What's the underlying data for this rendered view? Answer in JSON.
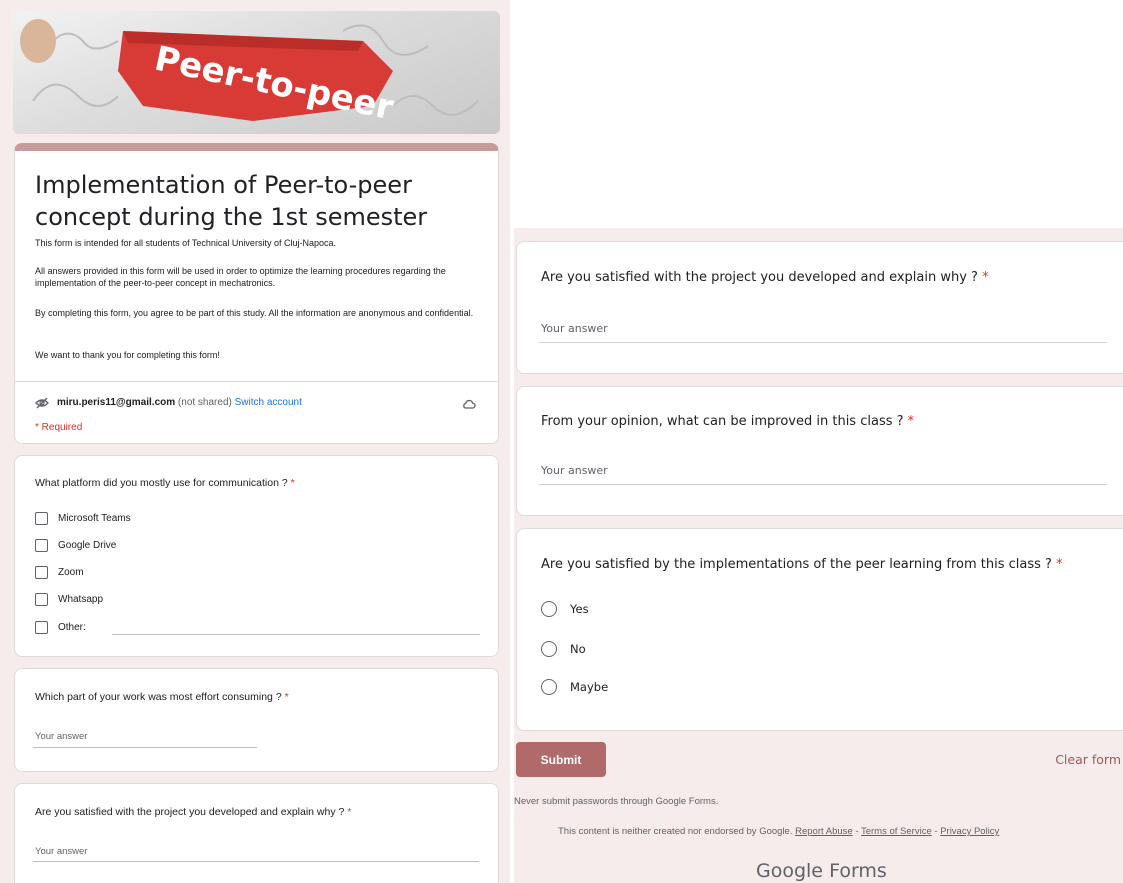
{
  "banner": {
    "text": "Peer-to-peer"
  },
  "form": {
    "title": "Implementation of Peer-to-peer concept during the 1st semester",
    "desc1": "This form is intended for all students of Technical University of Cluj-Napoca.",
    "desc2": "All answers provided in this form will be used in order to optimize the learning procedures regarding the implementation of the peer-to-peer concept in mechatronics.",
    "desc3": "By completing this form, you agree to be part of this study.  All the information are anonymous and confidential.",
    "desc4": "We want to thank you for completing this form!",
    "email": "miru.peris11@gmail.com",
    "not_shared": "(not shared)",
    "switch_account": "Switch account",
    "required": "* Required"
  },
  "q1": {
    "label": "What platform did you mostly use for communication ?",
    "options": [
      "Microsoft Teams",
      "Google Drive",
      "Zoom",
      "Whatsapp",
      "Other:"
    ]
  },
  "q2": {
    "label": "Which part of your work was most effort consuming ?",
    "placeholder": "Your answer"
  },
  "q3": {
    "label": "Are you satisfied with the project you developed and explain why ?",
    "placeholder": "Your answer"
  },
  "q4": {
    "label": "From your opinion, what can be improved in this class ?",
    "placeholder": "Your answer"
  },
  "q5": {
    "label": "Are you satisfied by the implementations of the peer learning from this class ?",
    "options": [
      "Yes",
      "No",
      "Maybe"
    ]
  },
  "star": "*",
  "actions": {
    "submit": "Submit",
    "clear": "Clear form"
  },
  "footer": {
    "warning": "Never submit passwords through Google Forms.",
    "disclaimer": "This content is neither created nor endorsed by Google.",
    "report_abuse": "Report Abuse",
    "sep": " - ",
    "terms": "Terms of Service",
    "privacy": "Privacy Policy",
    "brand_google": "Google",
    "brand_forms": "Forms"
  },
  "colors": {
    "accent": "#b06a6a",
    "required": "#d93025",
    "link": "#1a73e8",
    "background": "#f6ecec"
  }
}
